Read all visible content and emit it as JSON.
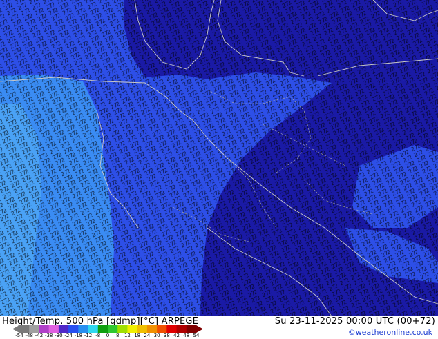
{
  "title": "Height/Temp. 500 hPa [gdmp][°C] ARPEGE",
  "valid_time": "Su 23-11-2025 00:00 UTC (00+72)",
  "credit": "©weatheronline.co.uk",
  "colors": {
    "cold_deep": "#1a1aa6",
    "mid_blue": "#2d4fe8",
    "light_blue": "#3a8cf4",
    "contour": "#000000",
    "coastline": "#c8c8c8"
  },
  "colorbar": {
    "ticks": [
      "-54",
      "-48",
      "-42",
      "-38",
      "-30",
      "-24",
      "-18",
      "-12",
      "-8",
      "0",
      "8",
      "12",
      "18",
      "24",
      "30",
      "38",
      "42",
      "48",
      "54"
    ],
    "colors": [
      "#7a7a7a",
      "#a0a0a0",
      "#b040c8",
      "#e060e0",
      "#5028c8",
      "#2850f0",
      "#2890f0",
      "#30d8f0",
      "#10a010",
      "#30c830",
      "#a0e000",
      "#f0f000",
      "#f0c000",
      "#f09000",
      "#f05000",
      "#e00000",
      "#b00000",
      "#800000"
    ]
  },
  "map": {
    "field": "500 hPa temperature",
    "contour_labels": [
      "27",
      "26",
      "25",
      "24",
      "23",
      "22",
      "21"
    ]
  }
}
